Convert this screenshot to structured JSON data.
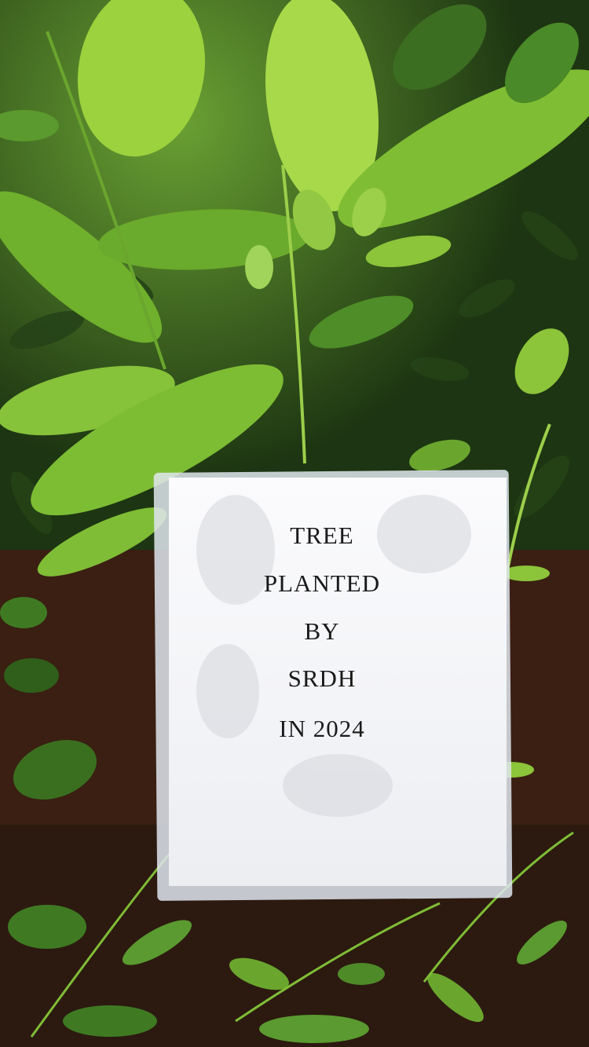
{
  "sign": {
    "lines": [
      "TREE",
      "PLANTED",
      "BY",
      "SRDH",
      "IN 2024"
    ]
  },
  "colors": {
    "foliage_dark": "#1f3a14",
    "foliage_mid": "#3f7a22",
    "foliage_light": "#8cc43a",
    "soil": "#3a1f12",
    "paper": "#f4f4f6",
    "text": "#1a1a1a"
  }
}
